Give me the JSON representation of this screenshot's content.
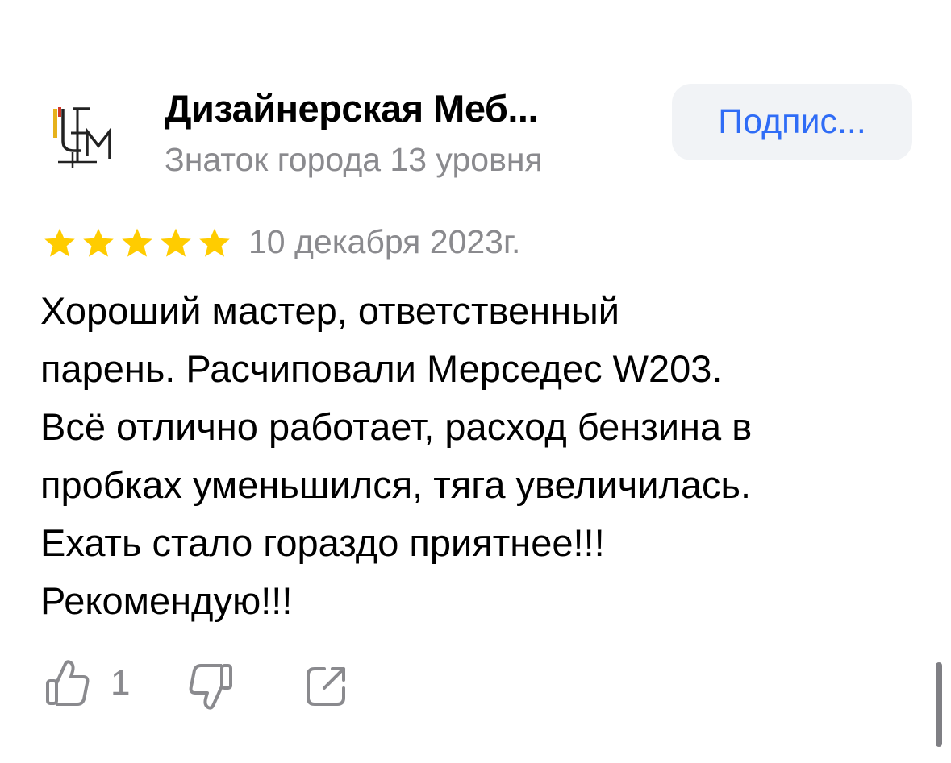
{
  "author": {
    "name": "Дизайнерская Меб...",
    "level": "Знаток города 13 уровня"
  },
  "subscribe": {
    "label": "Подпис..."
  },
  "review": {
    "rating": 5,
    "max_rating": 5,
    "date": "10 декабря 2023г.",
    "lines": [
      "Хороший мастер, ответственный",
      "парень. Расчиповали Мерседес W203.",
      "Всё отлично работает, расход бензина в",
      "пробках уменьшился, тяга увеличилась.",
      "Ехать стало гораздо приятнее!!!",
      "Рекомендую!!!"
    ]
  },
  "actions": {
    "like_count": "1",
    "like_icon": "thumb-up-icon",
    "dislike_icon": "thumb-down-icon",
    "share_icon": "share-icon"
  },
  "colors": {
    "accent": "#2f6cf6",
    "star": "#ffcc00",
    "muted_text": "#8a8a8e",
    "button_bg": "#f1f3f6"
  }
}
